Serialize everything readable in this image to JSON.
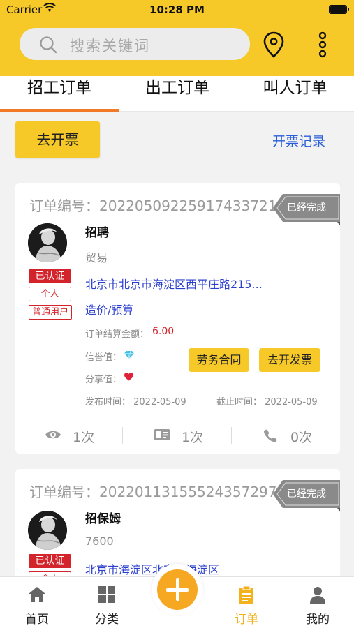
{
  "status_bar": {
    "carrier": "Carrier",
    "time": "10:28 PM"
  },
  "header": {
    "search_placeholder": "搜索关键词",
    "location_icon": "location-pin-icon",
    "more_icon": "more-vertical-icon"
  },
  "tabs": [
    {
      "label": "招工订单",
      "active": true
    },
    {
      "label": "出工订单",
      "active": false
    },
    {
      "label": "叫人订单",
      "active": false
    }
  ],
  "invoice": {
    "button_label": "去开票",
    "records_link": "开票记录"
  },
  "orders": [
    {
      "order_no": "订单编号：20220509225917433721",
      "status": "已经完成",
      "badges": [
        "已认证",
        "个人",
        "普通用户"
      ],
      "title": "招聘",
      "subtitle": "贸易",
      "address": "北京市北京市海淀区西平庄路215...",
      "price_type": "造价/预算",
      "amount_label": "订单结算金额：",
      "amount": "6.00",
      "credit_label": "信誉值：",
      "share_label": "分享值：",
      "contract_button": "劳务合同",
      "invoice_button": "去开发票",
      "publish_date": "发布时间：  2022-05-09",
      "deadline_date": "截止时间：  2022-05-09",
      "views": "1次",
      "cards": "1次",
      "calls": "0次"
    },
    {
      "order_no": "订单编号：20220113155524357297",
      "status": "已经完成",
      "badges": [
        "已认证",
        "个人"
      ],
      "title": "招保姆",
      "subtitle": "7600",
      "address": "北京市海淀区北京市海淀区"
    }
  ],
  "tabbar": [
    {
      "label": "首页",
      "icon": "home-icon"
    },
    {
      "label": "分类",
      "icon": "grid-icon"
    },
    {
      "label": "",
      "icon": "plus-icon"
    },
    {
      "label": "订单",
      "icon": "clipboard-icon",
      "active": true
    },
    {
      "label": "我的",
      "icon": "user-icon"
    }
  ],
  "colors": {
    "brand_yellow": "#f6c929",
    "tab_underline": "#f07a28",
    "red": "#d4242b",
    "link_blue": "#2b5fd9",
    "active_tab": "#f3b21b"
  }
}
